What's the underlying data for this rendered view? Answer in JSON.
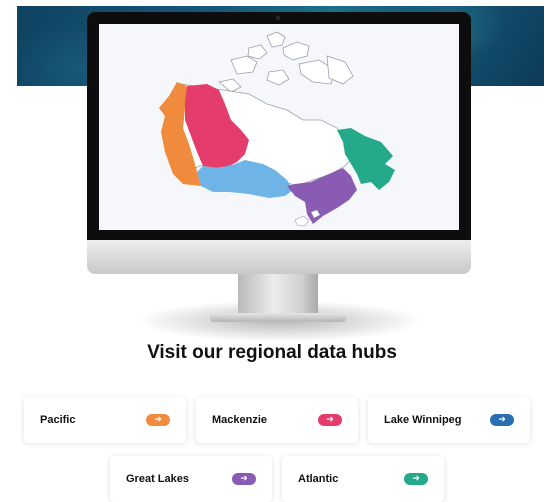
{
  "hero": {
    "heading": "Visit our regional data hubs"
  },
  "map": {
    "regions": [
      {
        "name": "Pacific",
        "color": "#f08a3c"
      },
      {
        "name": "Mackenzie",
        "color": "#e43d6b"
      },
      {
        "name": "Lake Winnipeg",
        "color": "#6fb4e6"
      },
      {
        "name": "Great Lakes",
        "color": "#8a5bb3"
      },
      {
        "name": "Atlantic",
        "color": "#24a98a"
      }
    ]
  },
  "hubs": [
    {
      "label": "Pacific",
      "icon": "arrow-right-icon",
      "color": "#f08a3c"
    },
    {
      "label": "Mackenzie",
      "icon": "arrow-right-icon",
      "color": "#e43d6b"
    },
    {
      "label": "Lake Winnipeg",
      "icon": "arrow-right-icon",
      "color": "#2b6fb3"
    },
    {
      "label": "Great Lakes",
      "icon": "arrow-right-icon",
      "color": "#8a5bb3"
    },
    {
      "label": "Atlantic",
      "icon": "arrow-right-icon",
      "color": "#24a98a"
    }
  ],
  "icons": {
    "arrow_glyph": "➜"
  }
}
